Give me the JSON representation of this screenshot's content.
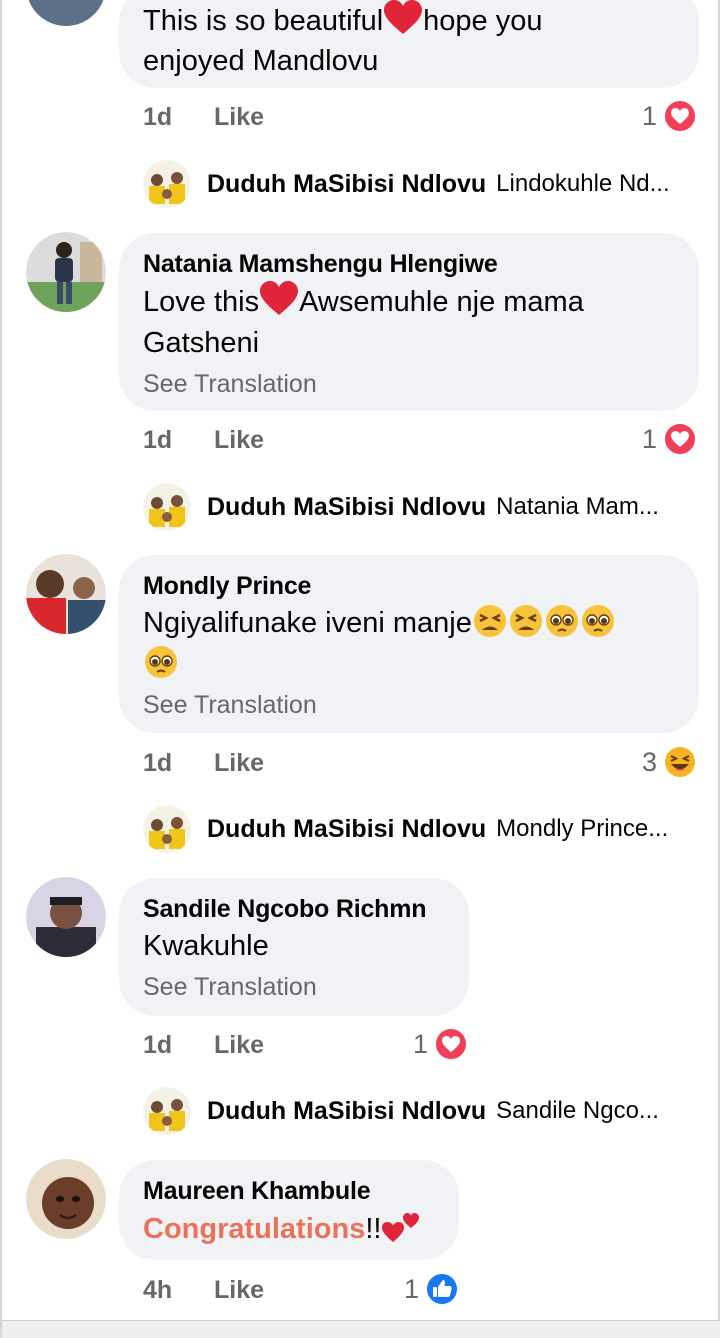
{
  "comments": [
    {
      "author": "",
      "text_line1_part1": "This is so beautiful",
      "text_line1_part2": "hope you",
      "text_line2": "enjoyed Mandlovu",
      "time": "1d",
      "like_label": "Like",
      "reaction_count": "1",
      "reaction_type": "heart-icon",
      "reply": {
        "author": "Duduh MaSibisi Ndlovu",
        "preview": "Lindokuhle Nd..."
      }
    },
    {
      "author": "Natania Mamshengu Hlengiwe",
      "text_part1": "Love this",
      "text_part2": "Awsemuhle nje mama",
      "text_line2": "Gatsheni",
      "see_translation": "See Translation",
      "time": "1d",
      "like_label": "Like",
      "reaction_count": "1",
      "reaction_type": "heart-icon",
      "reply": {
        "author": "Duduh MaSibisi Ndlovu",
        "preview": "Natania Mam..."
      }
    },
    {
      "author": "Mondly Prince",
      "text": "Ngiyalifunake iveni manje",
      "see_translation": "See Translation",
      "time": "1d",
      "like_label": "Like",
      "reaction_count": "3",
      "reaction_type": "haha-icon",
      "reply": {
        "author": "Duduh MaSibisi Ndlovu",
        "preview": "Mondly Prince..."
      }
    },
    {
      "author": "Sandile Ngcobo Richmn",
      "text": "Kwakuhle",
      "see_translation": "See Translation",
      "time": "1d",
      "like_label": "Like",
      "reaction_count": "1",
      "reaction_type": "heart-icon",
      "reply": {
        "author": "Duduh MaSibisi Ndlovu",
        "preview": "Sandile Ngco..."
      }
    },
    {
      "author": "Maureen Khambule",
      "text_highlight": "Congratulations",
      "text_suffix": "!!",
      "time": "4h",
      "like_label": "Like",
      "reaction_count": "1",
      "reaction_type": "like-icon"
    }
  ],
  "colors": {
    "bubble": "#f0f2f5",
    "meta": "#65676b",
    "heart": "#f33e58",
    "like_blue": "#1877f2",
    "congrats": "#e9735a"
  }
}
